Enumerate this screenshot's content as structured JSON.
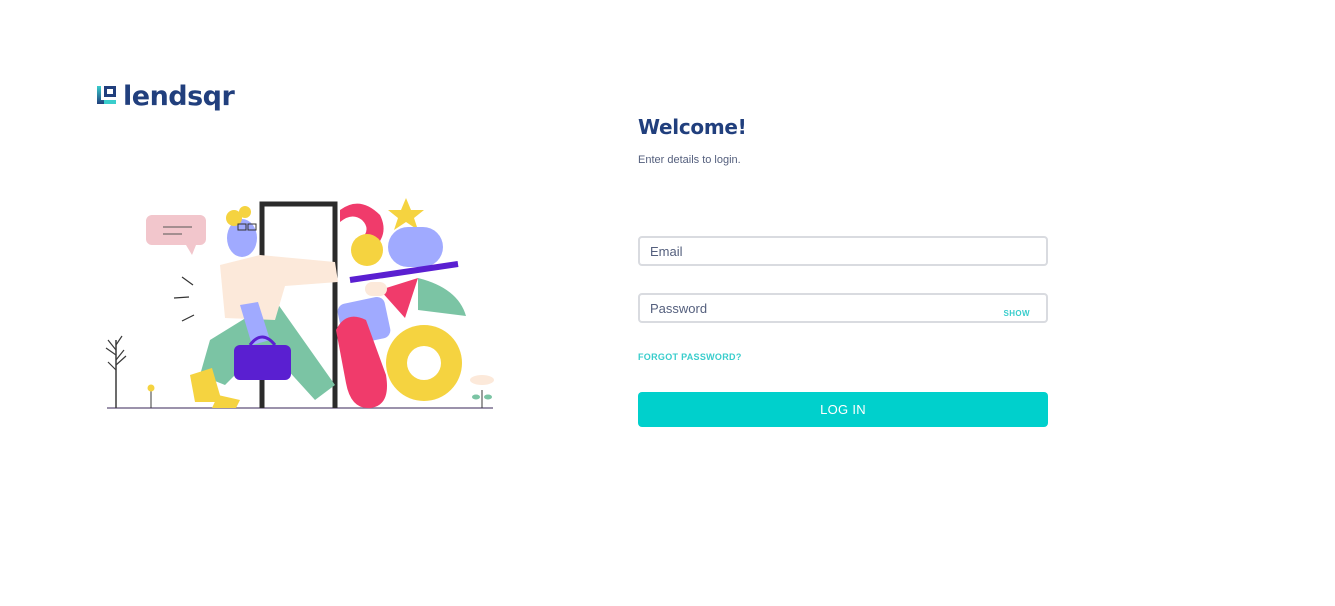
{
  "logo": {
    "text": "lendsqr",
    "icon": "lendsqr-logo-icon"
  },
  "login": {
    "title": "Welcome!",
    "subtitle": "Enter details to login.",
    "email_placeholder": "Email",
    "password_placeholder": "Password",
    "show_label": "SHOW",
    "forgot_label": "FORGOT PASSWORD?",
    "submit_label": "LOG IN"
  },
  "colors": {
    "brand_dark": "#213F7D",
    "accent": "#39CDCC",
    "button": "#00D0CC",
    "text_secondary": "#545F7D",
    "input_border": "#d9dbe0"
  }
}
